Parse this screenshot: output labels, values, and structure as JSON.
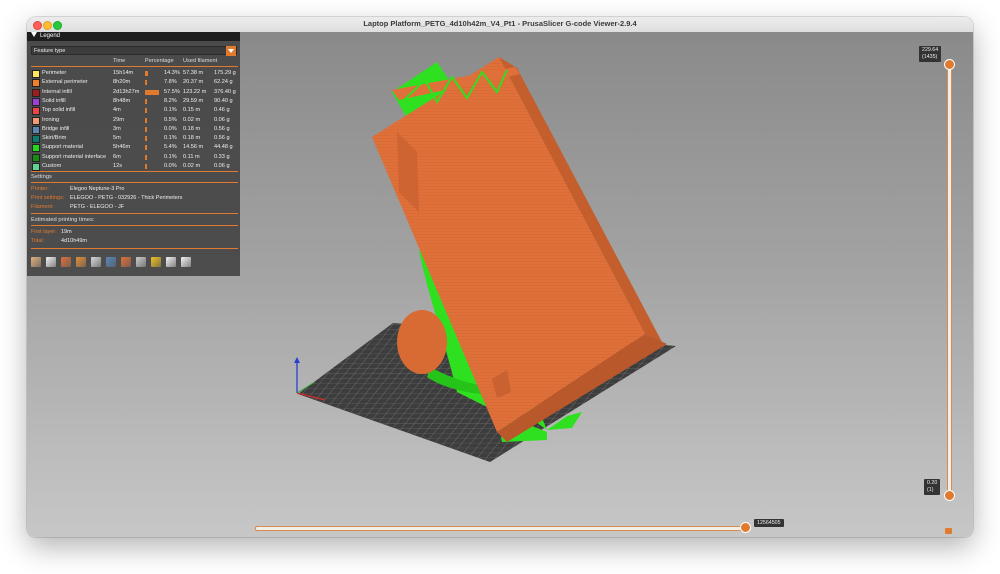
{
  "window": {
    "title": "Laptop Platform_PETG_4d10h42m_V4_Pt1 - PrusaSlicer G-code Viewer-2.9.4"
  },
  "legend": {
    "header": "Legend",
    "view_type": "Feature type",
    "columns": {
      "time": "Time",
      "percentage": "Percentage",
      "used_filament": "Used filament"
    },
    "features": [
      {
        "name": "Perimeter",
        "time": "15h14m",
        "percent": "14.3%",
        "pct": 14.3,
        "length": "57.38 m",
        "weight": "175.29 g",
        "color": "#ffe65a"
      },
      {
        "name": "External perimeter",
        "time": "8h20m",
        "percent": "7.8%",
        "pct": 7.8,
        "length": "20.37 m",
        "weight": "62.24 g",
        "color": "#f07f2a"
      },
      {
        "name": "Internal infill",
        "time": "2d13h27m",
        "percent": "57.5%",
        "pct": 57.5,
        "length": "123.22 m",
        "weight": "376.40 g",
        "color": "#a01b1b"
      },
      {
        "name": "Solid infill",
        "time": "8h48m",
        "percent": "8.2%",
        "pct": 8.2,
        "length": "29.59 m",
        "weight": "90.40 g",
        "color": "#9c3fd6"
      },
      {
        "name": "Top solid infill",
        "time": "4m",
        "percent": "0.1%",
        "pct": 0.1,
        "length": "0.15 m",
        "weight": "0.46 g",
        "color": "#f04444"
      },
      {
        "name": "Ironing",
        "time": "29m",
        "percent": "0.5%",
        "pct": 0.5,
        "length": "0.02 m",
        "weight": "0.06 g",
        "color": "#f29a72"
      },
      {
        "name": "Bridge infill",
        "time": "3m",
        "percent": "0.0%",
        "pct": 0.0,
        "length": "0.18 m",
        "weight": "0.56 g",
        "color": "#5a85b5"
      },
      {
        "name": "Skirt/Brim",
        "time": "5m",
        "percent": "0.1%",
        "pct": 0.1,
        "length": "0.18 m",
        "weight": "0.56 g",
        "color": "#0d7a6f"
      },
      {
        "name": "Support material",
        "time": "5h46m",
        "percent": "5.4%",
        "pct": 5.4,
        "length": "14.56 m",
        "weight": "44.48 g",
        "color": "#23d81d"
      },
      {
        "name": "Support material interface",
        "time": "6m",
        "percent": "0.1%",
        "pct": 0.1,
        "length": "0.11 m",
        "weight": "0.33 g",
        "color": "#188b14"
      },
      {
        "name": "Custom",
        "time": "12s",
        "percent": "0.0%",
        "pct": 0.0,
        "length": "0.02 m",
        "weight": "0.06 g",
        "color": "#5ed194"
      }
    ],
    "settings": {
      "heading": "Settings",
      "printer_label": "Printer:",
      "printer": "Elegoo Neptune-3 Pro",
      "print_label": "Print settings:",
      "print": "ELEGOO - PETG - 032926 - Thick Perimeters",
      "filament_label": "Filament:",
      "filament": "PETG - ELEGOO - JF"
    },
    "times": {
      "heading": "Estimated printing times:",
      "first_layer_label": "First layer:",
      "first_layer": "19m",
      "total_label": "Total:",
      "total": "4d10h49m"
    },
    "toolbar_icons": [
      "travel-icon",
      "wipe-icon",
      "retractions-icon",
      "deretractions-icon",
      "seams-icon",
      "tool-changes-icon",
      "color-changes-icon",
      "pause-prints-icon",
      "custom-gcodes-icon",
      "center-of-gravity-icon",
      "shells-icon"
    ]
  },
  "sliders": {
    "horizontal_value": "12564505",
    "horizontal_fraction": 0.99,
    "vertical_top_value": "229.64",
    "vertical_top_layer": "(1435)",
    "vertical_bottom_value": "0.20",
    "vertical_bottom_layer": "(1)"
  },
  "colors": {
    "accent": "#e07a2e",
    "model": "#e0703a",
    "support": "#2fe020",
    "bed": "#3d3d3d"
  }
}
